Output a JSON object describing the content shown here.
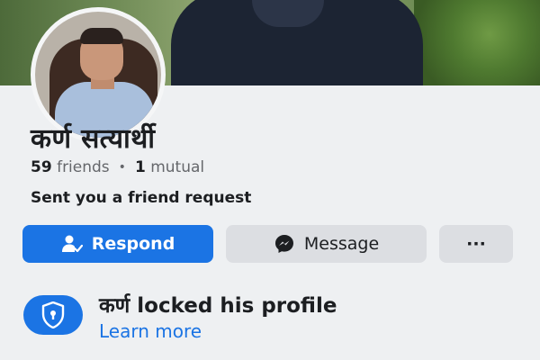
{
  "profile": {
    "name": "कर्ण सत्यार्थी",
    "friends_count": "59",
    "friends_label": "friends",
    "mutual_count": "1",
    "mutual_label": "mutual",
    "request_text": "Sent you a friend request"
  },
  "actions": {
    "respond_label": "Respond",
    "message_label": "Message",
    "more_label": "···"
  },
  "lock_notice": {
    "title": "कर्ण locked his profile",
    "link": "Learn more"
  },
  "icons": {
    "respond": "person-check-icon",
    "message": "messenger-icon",
    "lock": "shield-lock-icon"
  },
  "colors": {
    "accent": "#1b74e4",
    "secondary_button": "#dcdee2",
    "muted_text": "#65676b"
  }
}
